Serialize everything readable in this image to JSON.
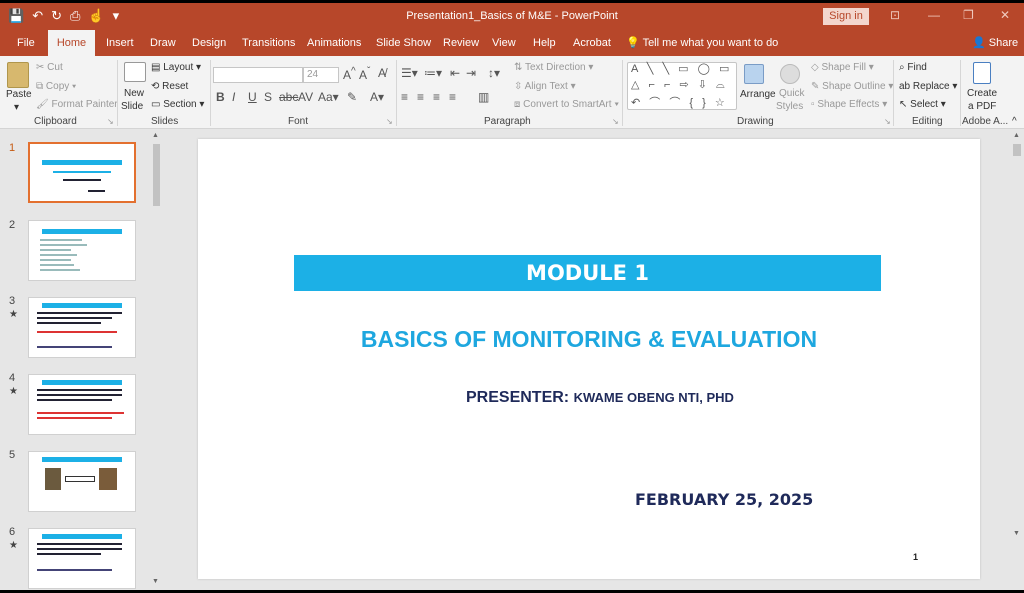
{
  "window": {
    "title": "Presentation1_Basics of M&E  -  PowerPoint",
    "signin": "Sign in"
  },
  "qat": [
    "💾",
    "↶",
    "↻",
    "⎙",
    "☝",
    "▾"
  ],
  "tabs": [
    "File",
    "Home",
    "Insert",
    "Draw",
    "Design",
    "Transitions",
    "Animations",
    "Slide Show",
    "Review",
    "View",
    "Help",
    "Acrobat"
  ],
  "tellme": "Tell me what you want to do",
  "share": "Share",
  "ribbon": {
    "clipboard": {
      "label": "Clipboard",
      "paste": "Paste",
      "cut": "Cut",
      "copy": "Copy",
      "format_painter": "Format Painter"
    },
    "slides": {
      "label": "Slides",
      "new_slide_1": "New",
      "new_slide_2": "Slide",
      "layout": "Layout",
      "reset": "Reset",
      "section": "Section"
    },
    "font": {
      "label": "Font",
      "size": "24"
    },
    "paragraph": {
      "label": "Paragraph",
      "text_direction": "Text Direction",
      "align_text": "Align Text",
      "convert": "Convert to SmartArt"
    },
    "drawing": {
      "label": "Drawing",
      "arrange": "Arrange",
      "quick_styles_1": "Quick",
      "quick_styles_2": "Styles",
      "shape_fill": "Shape Fill",
      "shape_outline": "Shape Outline",
      "shape_effects": "Shape Effects"
    },
    "editing": {
      "label": "Editing",
      "find": "Find",
      "replace": "Replace",
      "select": "Select"
    },
    "adobe": {
      "label": "Adobe A...",
      "create_1": "Create",
      "create_2": "a PDF"
    }
  },
  "thumbnails": [
    {
      "num": "1",
      "star": ""
    },
    {
      "num": "2",
      "star": ""
    },
    {
      "num": "3",
      "star": "★"
    },
    {
      "num": "4",
      "star": "★"
    },
    {
      "num": "5",
      "star": ""
    },
    {
      "num": "6",
      "star": "★"
    }
  ],
  "slide": {
    "module": "MODULE 1",
    "title": "BASICS OF MONITORING & EVALUATION",
    "presenter_label": "PRESENTER:",
    "presenter_name": "KWAME OBENG NTI, PHD",
    "date": "FEBRUARY 25, 2025",
    "page_number": "1"
  }
}
